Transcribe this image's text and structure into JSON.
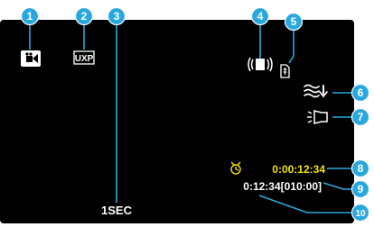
{
  "colors": {
    "screen": "#000000",
    "callout": "#29a8df",
    "callout_text": "#ffffff",
    "osd_white": "#ffffff",
    "osd_yellow": "#f3e000"
  },
  "icons": {
    "mode": "video-camera-icon",
    "quality": "uxp-badge",
    "stabilizer": "hand-shake-stabilizer-icon",
    "wind": "wind-cut-icon",
    "light": "led-light-icon",
    "timer": "clock-icon",
    "media": "sd-card-icon"
  },
  "osd": {
    "quality_label": "UXP",
    "interval": "1SEC",
    "elapsed": "0:00:12:34",
    "remaining": "0:12:34[010:00]"
  },
  "callouts": [
    "1",
    "2",
    "3",
    "4",
    "5",
    "6",
    "7",
    "8",
    "9",
    "10"
  ]
}
